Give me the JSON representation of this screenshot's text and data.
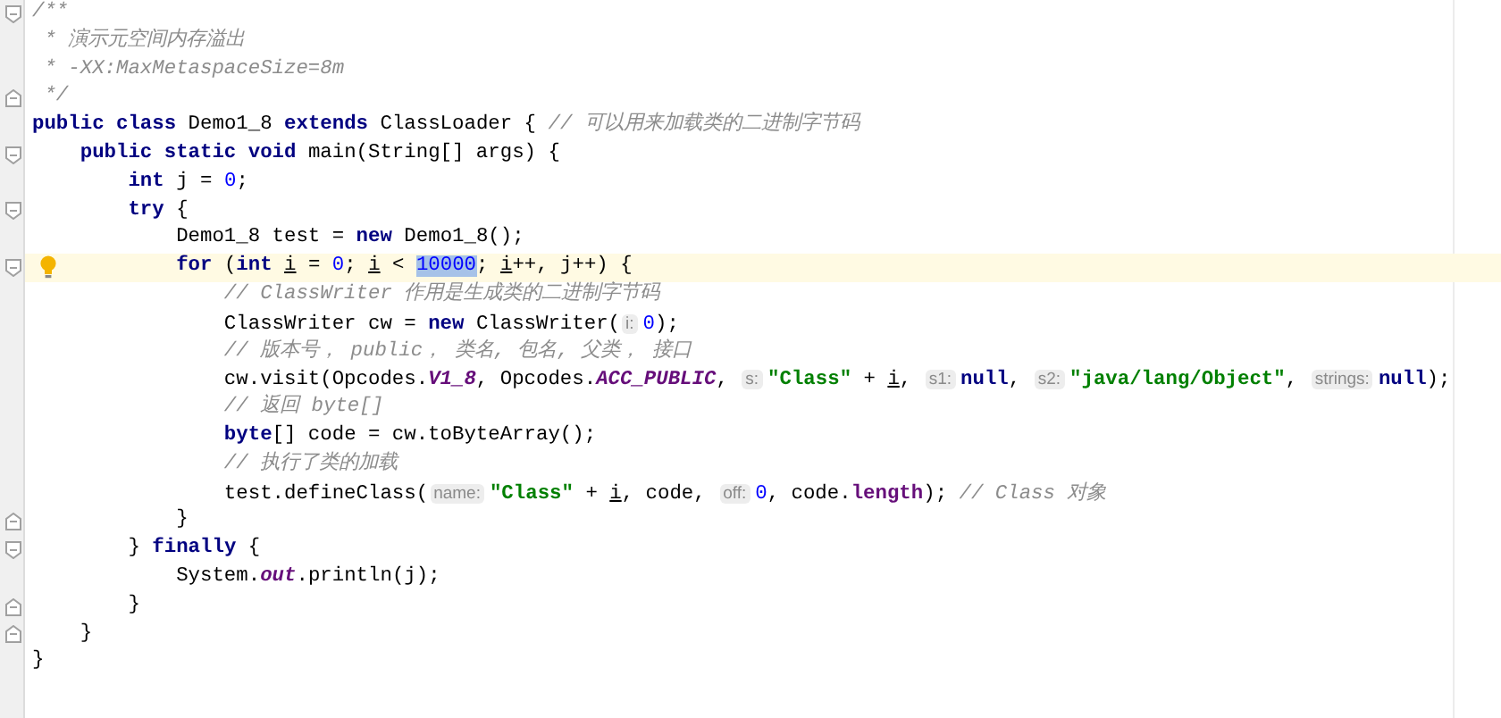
{
  "editor": {
    "lines": [
      {
        "kind": "code",
        "fold_open": true,
        "current": false,
        "tokens": [
          {
            "kind": "comment",
            "text": "/**"
          }
        ]
      },
      {
        "kind": "doc",
        "current": false,
        "tokens": [
          {
            "kind": "comment",
            "text": "* 演示元空间内存溢出"
          }
        ]
      },
      {
        "kind": "doc",
        "current": false,
        "tokens": [
          {
            "kind": "comment",
            "text": "* -XX:MaxMetaspaceSize=8m"
          }
        ]
      },
      {
        "kind": "doc",
        "fold_close": true,
        "current": false,
        "tokens": [
          {
            "kind": "comment",
            "text": "*/"
          }
        ]
      },
      {
        "kind": "code",
        "current": false,
        "tokens": [
          {
            "kind": "keyword",
            "text": "public class"
          },
          {
            "kind": "plain",
            "text": " Demo1_8 "
          },
          {
            "kind": "keyword",
            "text": "extends"
          },
          {
            "kind": "plain",
            "text": " ClassLoader { "
          },
          {
            "kind": "comment",
            "text": "// 可以用来加载类的二进制字节码"
          }
        ],
        "children": [
          {
            "kind": "code",
            "fold_open": true,
            "current": false,
            "tokens": [
              {
                "kind": "keyword",
                "text": "public static void"
              },
              {
                "kind": "plain",
                "text": " main(String[] args) {"
              }
            ],
            "children": [
              {
                "kind": "code",
                "current": false,
                "tokens": [
                  {
                    "kind": "keyword",
                    "text": "int"
                  },
                  {
                    "kind": "plain",
                    "text": " j = "
                  },
                  {
                    "kind": "number",
                    "text": "0"
                  },
                  {
                    "kind": "plain",
                    "text": ";"
                  }
                ]
              },
              {
                "kind": "code",
                "fold_open": true,
                "current": false,
                "tokens": [
                  {
                    "kind": "keyword",
                    "text": "try"
                  },
                  {
                    "kind": "plain",
                    "text": " {"
                  }
                ],
                "children": [
                  {
                    "kind": "code",
                    "current": false,
                    "tokens": [
                      {
                        "kind": "plain",
                        "text": "Demo1_8 test = "
                      },
                      {
                        "kind": "keyword",
                        "text": "new"
                      },
                      {
                        "kind": "plain",
                        "text": " Demo1_8();"
                      }
                    ]
                  },
                  {
                    "kind": "code",
                    "fold_open": true,
                    "current": true,
                    "bulb": true,
                    "tokens": [
                      {
                        "kind": "keyword",
                        "text": "for"
                      },
                      {
                        "kind": "plain",
                        "text": " ("
                      },
                      {
                        "kind": "keyword",
                        "text": "int "
                      },
                      {
                        "kind": "variable",
                        "text": "i"
                      },
                      {
                        "kind": "plain",
                        "text": " = "
                      },
                      {
                        "kind": "number",
                        "text": "0"
                      },
                      {
                        "kind": "plain",
                        "text": "; "
                      },
                      {
                        "kind": "variable",
                        "text": "i"
                      },
                      {
                        "kind": "plain",
                        "text": " < "
                      },
                      {
                        "kind": "selection",
                        "text": "10000"
                      },
                      {
                        "kind": "plain",
                        "text": "; "
                      },
                      {
                        "kind": "variable",
                        "text": "i"
                      },
                      {
                        "kind": "plain",
                        "text": "++, j++) {"
                      }
                    ],
                    "children": [
                      {
                        "kind": "code",
                        "current": false,
                        "tokens": [
                          {
                            "kind": "comment",
                            "text": "// ClassWriter 作用是生成类的二进制字节码"
                          }
                        ]
                      },
                      {
                        "kind": "code",
                        "current": false,
                        "tokens": [
                          {
                            "kind": "plain",
                            "text": "ClassWriter cw = "
                          },
                          {
                            "kind": "keyword",
                            "text": "new"
                          },
                          {
                            "kind": "plain",
                            "text": " ClassWriter("
                          },
                          {
                            "kind": "hint",
                            "text": "i:"
                          },
                          {
                            "kind": "number",
                            "text": "0"
                          },
                          {
                            "kind": "plain",
                            "text": ");"
                          }
                        ]
                      },
                      {
                        "kind": "code",
                        "current": false,
                        "tokens": [
                          {
                            "kind": "comment",
                            "text": "// 版本号， public， 类名, 包名, 父类， 接口"
                          }
                        ]
                      },
                      {
                        "kind": "code",
                        "current": false,
                        "tokens": [
                          {
                            "kind": "plain",
                            "text": "cw.visit(Opcodes."
                          },
                          {
                            "kind": "constant",
                            "text": "V1_8"
                          },
                          {
                            "kind": "plain",
                            "text": ", Opcodes."
                          },
                          {
                            "kind": "constant",
                            "text": "ACC_PUBLIC"
                          },
                          {
                            "kind": "plain",
                            "text": ", "
                          },
                          {
                            "kind": "hint",
                            "text": "s:"
                          },
                          {
                            "kind": "string",
                            "text": "\"Class\""
                          },
                          {
                            "kind": "plain",
                            "text": " + "
                          },
                          {
                            "kind": "variable",
                            "text": "i"
                          },
                          {
                            "kind": "plain",
                            "text": ", "
                          },
                          {
                            "kind": "hint",
                            "text": "s1:"
                          },
                          {
                            "kind": "keyword",
                            "text": "null"
                          },
                          {
                            "kind": "plain",
                            "text": ", "
                          },
                          {
                            "kind": "hint",
                            "text": "s2:"
                          },
                          {
                            "kind": "string",
                            "text": "\"java/lang/Object\""
                          },
                          {
                            "kind": "plain",
                            "text": ", "
                          },
                          {
                            "kind": "hint",
                            "text": "strings:"
                          },
                          {
                            "kind": "keyword",
                            "text": "null"
                          },
                          {
                            "kind": "plain",
                            "text": ");"
                          }
                        ]
                      },
                      {
                        "kind": "code",
                        "current": false,
                        "tokens": [
                          {
                            "kind": "comment",
                            "text": "// 返回 byte[]"
                          }
                        ]
                      },
                      {
                        "kind": "code",
                        "current": false,
                        "tokens": [
                          {
                            "kind": "keyword",
                            "text": "byte"
                          },
                          {
                            "kind": "plain",
                            "text": "[] code = cw.toByteArray();"
                          }
                        ]
                      },
                      {
                        "kind": "code",
                        "current": false,
                        "tokens": [
                          {
                            "kind": "comment",
                            "text": "// 执行了类的加载"
                          }
                        ]
                      },
                      {
                        "kind": "code",
                        "current": false,
                        "tokens": [
                          {
                            "kind": "plain",
                            "text": "test.defineClass("
                          },
                          {
                            "kind": "hint",
                            "text": "name:"
                          },
                          {
                            "kind": "string",
                            "text": "\"Class\""
                          },
                          {
                            "kind": "plain",
                            "text": " + "
                          },
                          {
                            "kind": "variable",
                            "text": "i"
                          },
                          {
                            "kind": "plain",
                            "text": ", code, "
                          },
                          {
                            "kind": "hint",
                            "text": "off:"
                          },
                          {
                            "kind": "number",
                            "text": "0"
                          },
                          {
                            "kind": "plain",
                            "text": ", code."
                          },
                          {
                            "kind": "field",
                            "text": "length"
                          },
                          {
                            "kind": "plain",
                            "text": "); "
                          },
                          {
                            "kind": "comment",
                            "text": "// Class 对象"
                          }
                        ]
                      }
                    ]
                  },
                  {
                    "kind": "code",
                    "fold_close": true,
                    "current": false,
                    "tokens": [
                      {
                        "kind": "plain",
                        "text": "}"
                      }
                    ]
                  }
                ]
              },
              {
                "kind": "code",
                "fold_open": true,
                "current": false,
                "tokens": [
                  {
                    "kind": "plain",
                    "text": "} "
                  },
                  {
                    "kind": "keyword",
                    "text": "finally"
                  },
                  {
                    "kind": "plain",
                    "text": " {"
                  }
                ],
                "children": [
                  {
                    "kind": "code",
                    "current": false,
                    "tokens": [
                      {
                        "kind": "plain",
                        "text": "System."
                      },
                      {
                        "kind": "constant",
                        "text": "out"
                      },
                      {
                        "kind": "plain",
                        "text": ".println(j);"
                      }
                    ]
                  }
                ]
              },
              {
                "kind": "code",
                "fold_close": true,
                "current": false,
                "tokens": [
                  {
                    "kind": "plain",
                    "text": "}"
                  }
                ]
              }
            ]
          },
          {
            "kind": "code",
            "fold_close": true,
            "current": false,
            "tokens": [
              {
                "kind": "plain",
                "text": "}"
              }
            ]
          }
        ]
      },
      {
        "kind": "code",
        "current": false,
        "tokens": [
          {
            "kind": "plain",
            "text": "}"
          }
        ]
      }
    ]
  }
}
